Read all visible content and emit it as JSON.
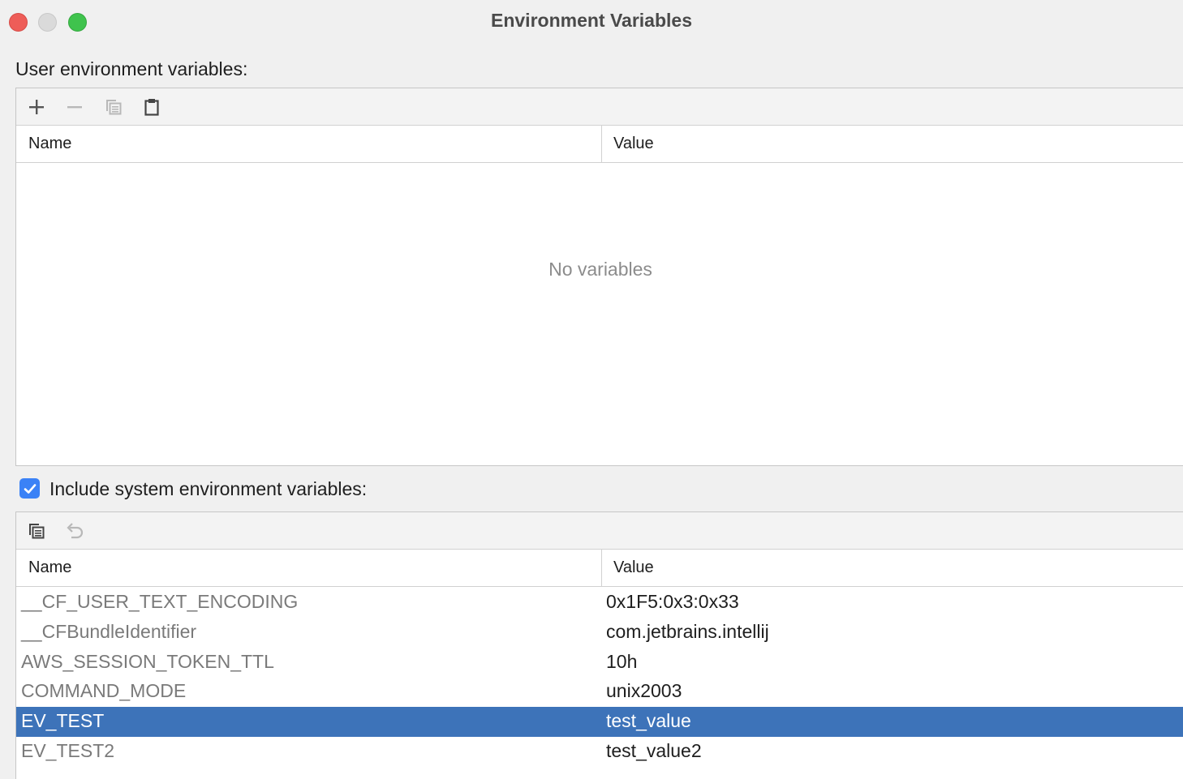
{
  "window": {
    "title": "Environment Variables"
  },
  "user_section": {
    "label": "User environment variables:",
    "columns": {
      "name": "Name",
      "value": "Value"
    },
    "empty_text": "No variables"
  },
  "system_section": {
    "checkbox_label": "Include system environment variables:",
    "checked": true,
    "columns": {
      "name": "Name",
      "value": "Value"
    },
    "rows": [
      {
        "name": "__CF_USER_TEXT_ENCODING",
        "value": "0x1F5:0x3:0x33",
        "selected": false
      },
      {
        "name": "__CFBundleIdentifier",
        "value": "com.jetbrains.intellij",
        "selected": false
      },
      {
        "name": "AWS_SESSION_TOKEN_TTL",
        "value": "10h",
        "selected": false
      },
      {
        "name": "COMMAND_MODE",
        "value": "unix2003",
        "selected": false
      },
      {
        "name": "EV_TEST",
        "value": "test_value",
        "selected": true
      },
      {
        "name": "EV_TEST2",
        "value": "test_value2",
        "selected": false
      }
    ]
  },
  "colors": {
    "selection": "#3d73b9",
    "checkbox": "#3b82f6",
    "close": "#ee5d58",
    "minimize": "#dadada",
    "maximize": "#3fc34d"
  },
  "icons": {
    "add": "plus-icon",
    "remove": "minus-icon",
    "copy": "copy-icon",
    "paste": "paste-icon",
    "revert": "undo-icon",
    "check": "checkmark-icon"
  }
}
